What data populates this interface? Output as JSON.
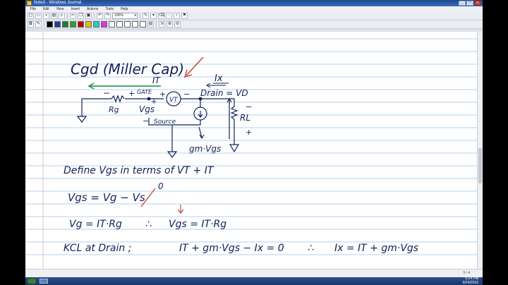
{
  "window": {
    "title": "Note3 - Windows Journal",
    "controls": [
      "_",
      "□",
      "×"
    ]
  },
  "menu": [
    "File",
    "Edit",
    "View",
    "Insert",
    "Actions",
    "Tools",
    "Help"
  ],
  "toolbar": {
    "zoom": "100%",
    "icons": [
      "new-page",
      "open",
      "save",
      "print",
      "find",
      "cut",
      "copy",
      "paste",
      "undo",
      "redo",
      "insert-space",
      "pen",
      "highlighter",
      "eraser",
      "lasso",
      "flag"
    ],
    "icons2": [
      "bold",
      "pen-black",
      "pen-blue",
      "pen-green",
      "pen-red"
    ],
    "pen_colors": [
      "#000000",
      "#1f3f9e",
      "#1e7b34",
      "#2aa12a",
      "#c00000",
      "#e0c000",
      "#20d0d0",
      "#e030e0",
      "#ffffff",
      "#ffffff",
      "#ffffff",
      "#ffffff",
      "#ffffff"
    ],
    "icons3": [
      "pen-settings",
      "selection-tool",
      "zoom-in",
      "zoom-out"
    ]
  },
  "note": {
    "heading": "Cgd (Miller Cap)",
    "circuit": {
      "current_IT": "IT",
      "current_Ix": "Ix",
      "drain": "Drain = VD",
      "gate": "GATE",
      "minus_gate": "−",
      "plus_gate": "+",
      "plus_vt": "+",
      "minus_vt": "−",
      "source_vt": "VT",
      "rg": "Rg",
      "vgs": "Vgs",
      "minus_vgs": "−",
      "source": "Source",
      "plus_vgs": "+",
      "rl": "RL",
      "rl_minus": "−",
      "rl_plus": "+",
      "gm": "gm·Vgs"
    },
    "lines": [
      "Define Vgs in terms of VT + IT",
      "Vgs = Vg − Vs",
      "0",
      "Vg = IT·Rg",
      "∴",
      "Vgs = IT·Rg",
      "KCL at Drain ;",
      "IT + gm·Vgs − Ix = 0",
      "∴",
      "Ix = IT + gm·Vgs"
    ]
  },
  "status": {
    "page_count": "3 / 4"
  },
  "taskbar": {
    "time": "5:24 PM",
    "date": "6/24/2016"
  }
}
